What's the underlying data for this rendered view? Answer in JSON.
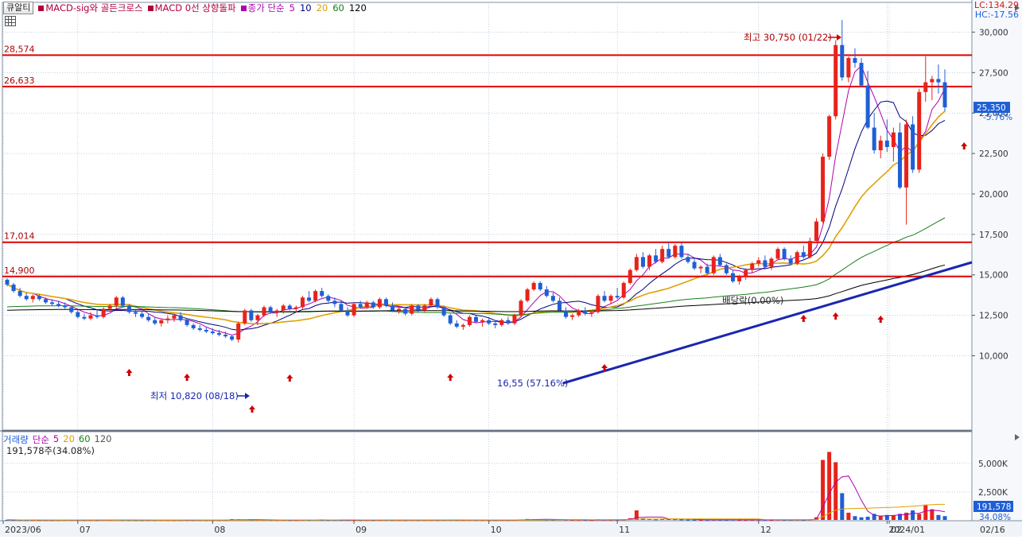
{
  "legend": {
    "button": "큐알티",
    "items": [
      {
        "label": "MACD-sig와 골든크로스",
        "color": "#b0003a"
      },
      {
        "label": "MACD 0선 상향돌파",
        "color": "#b0003a"
      },
      {
        "label": "종가 단순",
        "color": "#b000b0"
      },
      {
        "label": "5",
        "color": "#b000b0"
      },
      {
        "label": "10",
        "color": "#000080"
      },
      {
        "label": "20",
        "color": "#e0a000"
      },
      {
        "label": "60",
        "color": "#1a7f1a"
      },
      {
        "label": "120",
        "color": "#000000"
      }
    ]
  },
  "corner": {
    "lc": "LC:134.29",
    "hc": "HC:-17.56"
  },
  "price_axis": {
    "ticks": [
      "30,000",
      "27,500",
      "25,000",
      "22,500",
      "20,000",
      "17,500",
      "15,000",
      "12,500",
      "10,000"
    ],
    "current_price": "25,350",
    "current_change": "-5.76%"
  },
  "volume_axis": {
    "ticks": [
      "5,000K",
      "2,500K"
    ],
    "current_volume": "191,578",
    "current_ratio": "34.08%"
  },
  "x_axis": {
    "ticks": [
      "2023/06",
      "07",
      "08",
      "09",
      "10",
      "11",
      "12",
      "2024/01",
      "02"
    ],
    "end_label": "02/16"
  },
  "hlines": [
    {
      "label": "28,574",
      "value": 28574
    },
    {
      "label": "26,633",
      "value": 26633
    },
    {
      "label": "17,014",
      "value": 17014
    },
    {
      "label": "14,900",
      "value": 14900
    }
  ],
  "annotations": {
    "high": "최고 30,750 (01/22)",
    "low": "최저 10,820 (08/18)",
    "trend_gain": "16,55 (57.16%)",
    "dividend": "배당락(0.00%)"
  },
  "volume_legend": {
    "items": [
      {
        "label": "거래량",
        "color": "#1f5fd6"
      },
      {
        "label": "단순",
        "color": "#b000b0"
      },
      {
        "label": "5",
        "color": "#b000b0"
      },
      {
        "label": "20",
        "color": "#e0a000"
      },
      {
        "label": "60",
        "color": "#1a7f1a"
      },
      {
        "label": "120",
        "color": "#555555"
      }
    ],
    "current": "191,578주(34.08%)"
  },
  "colors": {
    "up": "#e8231a",
    "down": "#1f5fd6",
    "hline": "#e00000",
    "trend": "#1a26b0",
    "grid": "#9ab4cc"
  },
  "chart_data": {
    "type": "candlestick",
    "series_ohlc": [
      [
        14700,
        14800,
        14300,
        14400
      ],
      [
        14400,
        14500,
        13900,
        14000
      ],
      [
        14000,
        14200,
        13600,
        13700
      ],
      [
        13700,
        13900,
        13400,
        13500
      ],
      [
        13500,
        13800,
        13300,
        13700
      ],
      [
        13700,
        13800,
        13400,
        13500
      ],
      [
        13500,
        13600,
        13200,
        13300
      ],
      [
        13300,
        13500,
        13100,
        13200
      ],
      [
        13200,
        13400,
        13000,
        13100
      ],
      [
        13100,
        13300,
        12900,
        13000
      ],
      [
        13000,
        13100,
        12600,
        12700
      ],
      [
        12700,
        12900,
        12300,
        12400
      ],
      [
        12400,
        12600,
        12200,
        12300
      ],
      [
        12300,
        12700,
        12200,
        12500
      ],
      [
        12500,
        12800,
        12300,
        12400
      ],
      [
        12400,
        13000,
        12300,
        12900
      ],
      [
        12900,
        13200,
        12700,
        13100
      ],
      [
        13100,
        13700,
        12900,
        13600
      ],
      [
        13600,
        13700,
        13000,
        13100
      ],
      [
        13100,
        13200,
        12600,
        12700
      ],
      [
        12700,
        12900,
        12400,
        12600
      ],
      [
        12600,
        12800,
        12300,
        12400
      ],
      [
        12400,
        12600,
        12100,
        12200
      ],
      [
        12200,
        12400,
        11900,
        12000
      ],
      [
        12000,
        12300,
        11800,
        12200
      ],
      [
        12200,
        12500,
        12000,
        12300
      ],
      [
        12300,
        12600,
        12100,
        12500
      ],
      [
        12500,
        12700,
        12100,
        12200
      ],
      [
        12200,
        12300,
        11800,
        11900
      ],
      [
        11900,
        12000,
        11600,
        11700
      ],
      [
        11700,
        11900,
        11500,
        11600
      ],
      [
        11600,
        11800,
        11400,
        11500
      ],
      [
        11500,
        11700,
        11300,
        11400
      ],
      [
        11400,
        11600,
        11200,
        11300
      ],
      [
        11300,
        11500,
        11100,
        11200
      ],
      [
        11200,
        11300,
        10900,
        11000
      ],
      [
        11000,
        12100,
        10820,
        12000
      ],
      [
        12000,
        12900,
        11900,
        12800
      ],
      [
        12800,
        12900,
        12100,
        12200
      ],
      [
        12200,
        12600,
        11900,
        12500
      ],
      [
        12500,
        13100,
        12400,
        13000
      ],
      [
        13000,
        13100,
        12600,
        12700
      ],
      [
        12700,
        12900,
        12400,
        12800
      ],
      [
        12800,
        13200,
        12600,
        13100
      ],
      [
        13100,
        13200,
        12800,
        12900
      ],
      [
        12900,
        13100,
        12700,
        13000
      ],
      [
        13000,
        13700,
        12900,
        13600
      ],
      [
        13600,
        14000,
        13300,
        13400
      ],
      [
        13400,
        14100,
        13300,
        14000
      ],
      [
        14000,
        14200,
        13600,
        13700
      ],
      [
        13700,
        13800,
        13300,
        13400
      ],
      [
        13400,
        13600,
        13000,
        13200
      ],
      [
        13200,
        13400,
        12700,
        12800
      ],
      [
        12800,
        13000,
        12400,
        12500
      ],
      [
        12500,
        13300,
        12400,
        13200
      ],
      [
        13200,
        13400,
        12900,
        13000
      ],
      [
        13000,
        13400,
        12900,
        13300
      ],
      [
        13300,
        13400,
        12900,
        13000
      ],
      [
        13000,
        13600,
        12900,
        13500
      ],
      [
        13500,
        13600,
        13000,
        13100
      ],
      [
        13100,
        13300,
        12700,
        12800
      ],
      [
        12800,
        13100,
        12600,
        12900
      ],
      [
        12900,
        13000,
        12500,
        12600
      ],
      [
        12600,
        13200,
        12500,
        13100
      ],
      [
        13100,
        13200,
        12700,
        12800
      ],
      [
        12800,
        13200,
        12700,
        13100
      ],
      [
        13100,
        13600,
        13000,
        13500
      ],
      [
        13500,
        13600,
        12900,
        13000
      ],
      [
        13000,
        13100,
        12400,
        12500
      ],
      [
        12500,
        12600,
        11900,
        12000
      ],
      [
        12000,
        12200,
        11700,
        11800
      ],
      [
        11800,
        12000,
        11600,
        11900
      ],
      [
        11900,
        12500,
        11800,
        12400
      ],
      [
        12400,
        12500,
        12000,
        12100
      ],
      [
        12100,
        12300,
        11800,
        12200
      ],
      [
        12200,
        12400,
        11900,
        12000
      ],
      [
        12000,
        12200,
        11700,
        11900
      ],
      [
        11900,
        12300,
        11800,
        12200
      ],
      [
        12200,
        12400,
        11900,
        12000
      ],
      [
        12000,
        12600,
        11900,
        12500
      ],
      [
        12500,
        13500,
        12400,
        13400
      ],
      [
        13400,
        14200,
        13300,
        14100
      ],
      [
        14100,
        14600,
        14000,
        14500
      ],
      [
        14500,
        14600,
        14000,
        14100
      ],
      [
        14100,
        14300,
        13600,
        13700
      ],
      [
        13700,
        13900,
        13300,
        13400
      ],
      [
        13400,
        13600,
        12700,
        12800
      ],
      [
        12800,
        13000,
        12300,
        12400
      ],
      [
        12400,
        12600,
        12200,
        12500
      ],
      [
        12500,
        12900,
        12400,
        12800
      ],
      [
        12800,
        13000,
        12500,
        12600
      ],
      [
        12600,
        12800,
        12400,
        12700
      ],
      [
        12700,
        13800,
        12600,
        13700
      ],
      [
        13700,
        14000,
        13300,
        13400
      ],
      [
        13400,
        13800,
        13200,
        13700
      ],
      [
        13700,
        14200,
        13500,
        13600
      ],
      [
        13600,
        14600,
        13500,
        14500
      ],
      [
        14500,
        15400,
        14400,
        15300
      ],
      [
        15300,
        16300,
        15200,
        16100
      ],
      [
        16100,
        16400,
        15400,
        15500
      ],
      [
        15500,
        16300,
        15300,
        16200
      ],
      [
        16200,
        16600,
        15700,
        15800
      ],
      [
        15800,
        16800,
        15700,
        16600
      ],
      [
        16600,
        17000,
        16000,
        16100
      ],
      [
        16100,
        16900,
        16000,
        16800
      ],
      [
        16800,
        17000,
        16000,
        16100
      ],
      [
        16100,
        16300,
        15700,
        15800
      ],
      [
        15800,
        16000,
        15300,
        15400
      ],
      [
        15400,
        15600,
        15100,
        15500
      ],
      [
        15500,
        15700,
        15000,
        15100
      ],
      [
        15100,
        16200,
        15000,
        16100
      ],
      [
        16100,
        16300,
        15500,
        15600
      ],
      [
        15600,
        15700,
        15000,
        15100
      ],
      [
        15100,
        15300,
        14500,
        14600
      ],
      [
        14600,
        15000,
        14400,
        14900
      ],
      [
        14900,
        15400,
        14700,
        15300
      ],
      [
        15300,
        15800,
        15100,
        15700
      ],
      [
        15700,
        16100,
        15500,
        15900
      ],
      [
        15900,
        16200,
        15400,
        15500
      ],
      [
        15500,
        16100,
        15300,
        16000
      ],
      [
        16000,
        16700,
        15900,
        16600
      ],
      [
        16600,
        16700,
        15900,
        16000
      ],
      [
        16000,
        16200,
        15600,
        15700
      ],
      [
        15700,
        16500,
        15600,
        16400
      ],
      [
        16400,
        16800,
        16000,
        16100
      ],
      [
        16100,
        17300,
        16000,
        17100
      ],
      [
        17100,
        18500,
        17000,
        18300
      ],
      [
        18300,
        22500,
        18200,
        22300
      ],
      [
        22300,
        24900,
        22100,
        24800
      ],
      [
        24800,
        29500,
        24600,
        29200
      ],
      [
        29200,
        30750,
        27000,
        27200
      ],
      [
        27200,
        28500,
        26900,
        28400
      ],
      [
        28400,
        29000,
        27800,
        28100
      ],
      [
        28100,
        28400,
        26600,
        26700
      ],
      [
        26700,
        27600,
        24000,
        24100
      ],
      [
        24100,
        25000,
        22500,
        22700
      ],
      [
        22700,
        23600,
        22200,
        23300
      ],
      [
        23300,
        24600,
        22600,
        22900
      ],
      [
        22900,
        24100,
        22000,
        23800
      ],
      [
        23800,
        24400,
        20300,
        20400
      ],
      [
        20400,
        24600,
        18100,
        24300
      ],
      [
        24300,
        24800,
        21300,
        21500
      ],
      [
        21500,
        26500,
        21300,
        26300
      ],
      [
        26300,
        28500,
        25700,
        26900
      ],
      [
        26900,
        27300,
        25800,
        27100
      ],
      [
        27100,
        28000,
        26200,
        26900
      ],
      [
        26900,
        27700,
        25100,
        25350
      ]
    ],
    "volume_k": [
      80,
      70,
      60,
      55,
      60,
      50,
      55,
      45,
      50,
      60,
      70,
      65,
      55,
      60,
      50,
      80,
      70,
      90,
      60,
      55,
      50,
      45,
      55,
      50,
      60,
      55,
      45,
      50,
      60,
      55,
      50,
      45,
      40,
      50,
      55,
      140,
      120,
      90,
      70,
      80,
      75,
      60,
      65,
      70,
      55,
      60,
      80,
      70,
      90,
      65,
      55,
      60,
      70,
      75,
      65,
      55,
      60,
      50,
      70,
      65,
      55,
      60,
      50,
      70,
      60,
      55,
      65,
      60,
      70,
      75,
      60,
      55,
      65,
      60,
      55,
      50,
      55,
      60,
      55,
      65,
      110,
      150,
      130,
      100,
      90,
      80,
      120,
      100,
      70,
      60,
      65,
      55,
      120,
      90,
      80,
      70,
      110,
      220,
      900,
      200,
      150,
      120,
      180,
      140,
      130,
      110,
      90,
      80,
      70,
      60,
      100,
      90,
      80,
      110,
      70,
      80,
      90,
      100,
      90,
      70,
      110,
      90,
      80,
      100,
      70,
      120,
      300,
      5300,
      6000,
      5100,
      2400,
      700,
      400,
      300,
      350,
      600,
      400,
      500,
      450,
      600,
      700,
      900,
      600,
      1400,
      1000,
      500,
      400,
      191.578
    ],
    "hlines": [
      28574,
      26633,
      17014,
      14900
    ],
    "ylim": [
      9000,
      31600
    ],
    "ma_periods": [
      5,
      10,
      20,
      60,
      120
    ]
  }
}
